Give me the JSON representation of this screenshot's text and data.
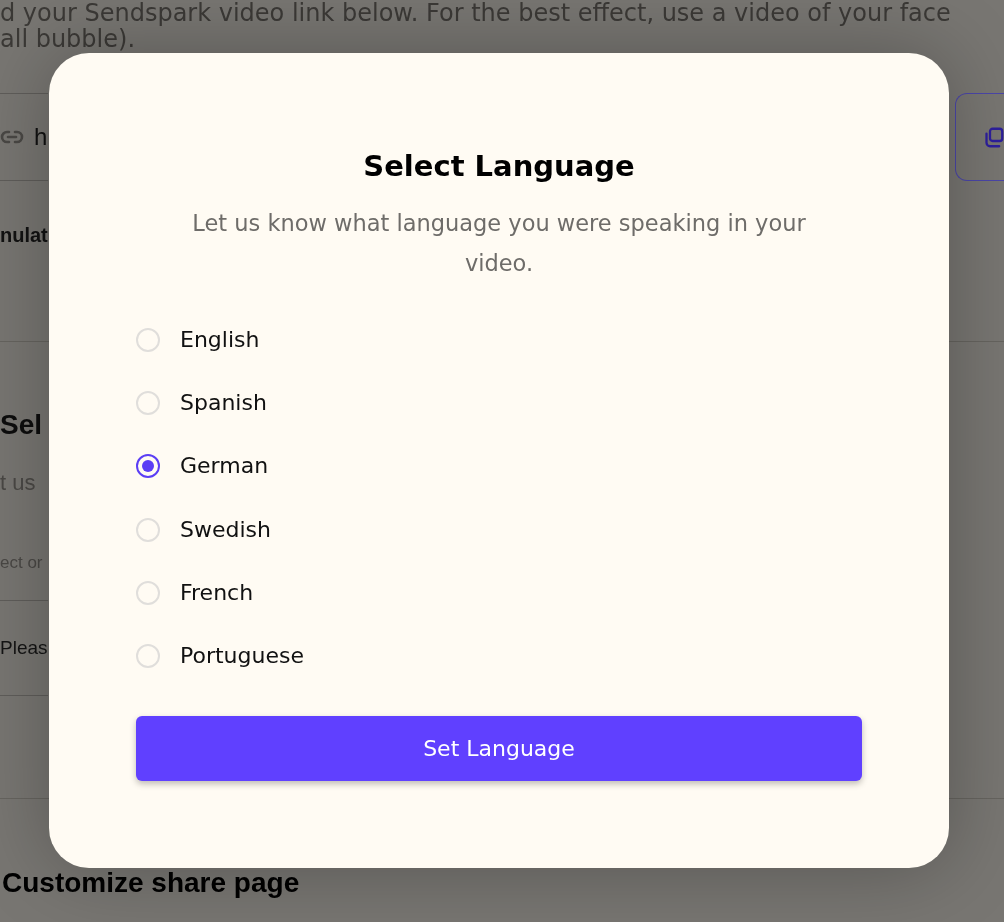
{
  "background": {
    "intro_lines": [
      "d your Sendspark video link below. For the best effect, use a video of your face",
      "all bubble)."
    ],
    "link_field": {
      "value": "h"
    },
    "section_label": "nulat",
    "section_title": "Sel",
    "section_subtitle": "t us",
    "section_hint": "ect or",
    "select_field": {
      "value": "Pleas"
    },
    "heading": "Customize share page"
  },
  "modal": {
    "title": "Select Language",
    "subtitle": "Let us know what language you were speaking in your video.",
    "options": [
      {
        "label": "English",
        "selected": false
      },
      {
        "label": "Spanish",
        "selected": false
      },
      {
        "label": "German",
        "selected": true
      },
      {
        "label": "Swedish",
        "selected": false
      },
      {
        "label": "French",
        "selected": false
      },
      {
        "label": "Portuguese",
        "selected": false
      }
    ],
    "button": "Set Language"
  }
}
